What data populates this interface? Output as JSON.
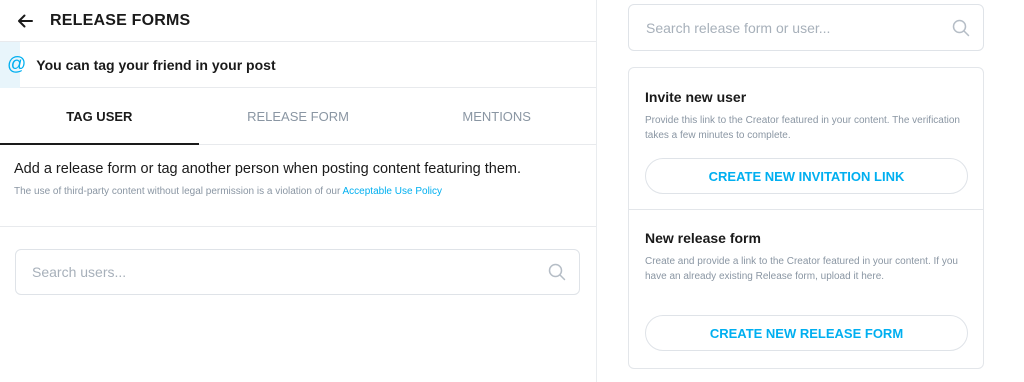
{
  "header": {
    "title": "RELEASE FORMS",
    "back_icon": "arrow-left-icon"
  },
  "banner": {
    "icon": "at-sign-icon",
    "symbol": "@",
    "text": "You can tag your friend in your post"
  },
  "tabs": [
    {
      "label": "TAG USER",
      "active": true
    },
    {
      "label": "RELEASE FORM",
      "active": false
    },
    {
      "label": "MENTIONS",
      "active": false
    }
  ],
  "description": {
    "main": "Add a release form or tag another person when posting content featuring them.",
    "sub_prefix": "The use of third-party content without legal permission is a violation of our ",
    "link": "Acceptable Use Policy"
  },
  "search_users": {
    "placeholder": "Search users...",
    "icon": "search-icon"
  },
  "search_forms": {
    "placeholder": "Search release form or user...",
    "icon": "search-icon"
  },
  "invite": {
    "title": "Invite new user",
    "text": "Provide this link to the Creator featured in your content. The verification takes a few minutes to complete.",
    "button": "CREATE NEW INVITATION LINK"
  },
  "new_form": {
    "title": "New release form",
    "text": "Create and provide a link to the Creator featured in your content. If you have an already existing Release form, upload it here.",
    "button": "CREATE NEW RELEASE FORM"
  },
  "colors": {
    "accent": "#00aff0",
    "muted": "#8a96a3",
    "banner_bg": "#e8f5fb"
  }
}
